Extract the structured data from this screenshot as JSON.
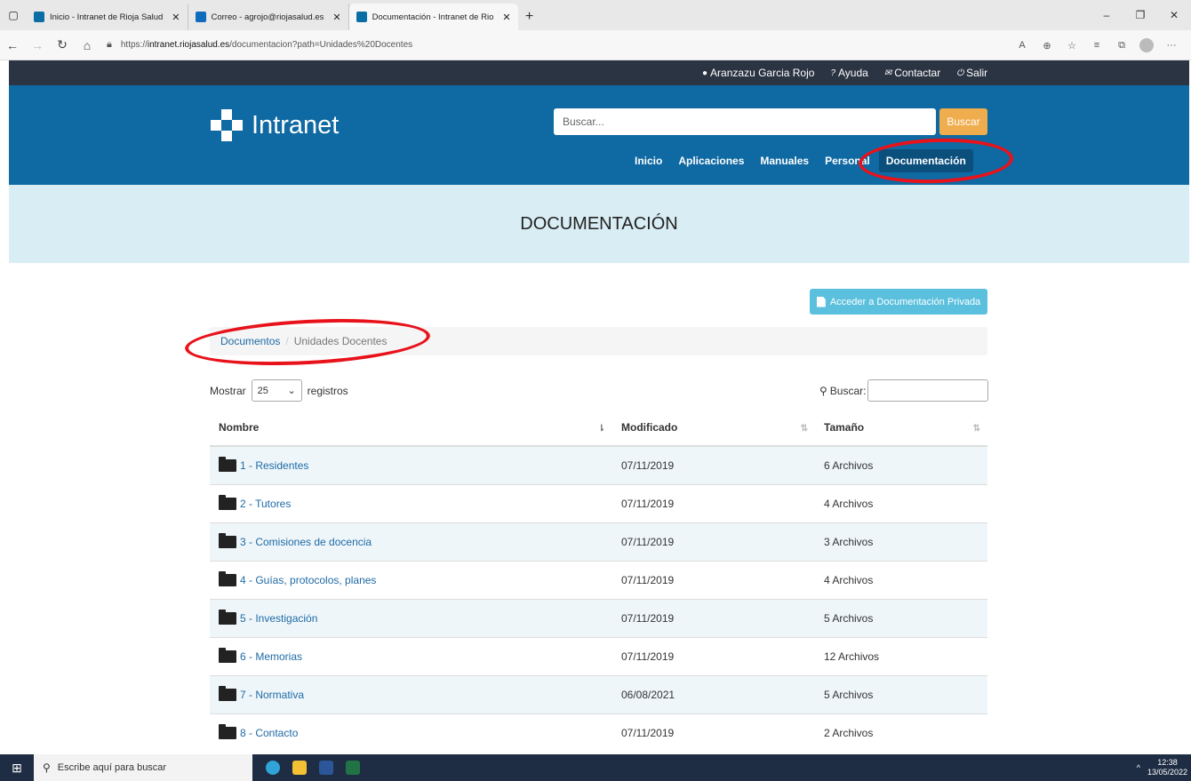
{
  "browser": {
    "tabs": [
      {
        "title": "Inicio - Intranet de Rioja Salud"
      },
      {
        "title": "Correo - agrojo@riojasalud.es"
      },
      {
        "title": "Documentación - Intranet de Rio"
      }
    ],
    "url_prefix": "https://",
    "url_host": "intranet.riojasalud.es",
    "url_path": "/documentacion?path=Unidades%20Docentes"
  },
  "topbar": {
    "user": "Aranzazu Garcia Rojo",
    "help": "Ayuda",
    "contact": "Contactar",
    "logout": "Salir"
  },
  "header": {
    "logo_text": "Intranet",
    "search_placeholder": "Buscar...",
    "search_button": "Buscar",
    "nav": [
      "Inicio",
      "Aplicaciones",
      "Manuales",
      "Personal",
      "Documentación"
    ]
  },
  "page": {
    "title": "DOCUMENTACIÓN",
    "private_button": "Acceder a Documentación Privada",
    "breadcrumb": {
      "root": "Documentos",
      "separator": "/",
      "current": "Unidades Docentes"
    },
    "show_label": "Mostrar",
    "show_value": "25",
    "records_label": "registros",
    "filter_label": "Buscar:"
  },
  "table": {
    "headers": [
      "Nombre",
      "Modificado",
      "Tamaño"
    ],
    "rows": [
      {
        "name": "1 - Residentes",
        "modified": "07/11/2019",
        "size": "6 Archivos"
      },
      {
        "name": "2 - Tutores",
        "modified": "07/11/2019",
        "size": "4 Archivos"
      },
      {
        "name": "3 - Comisiones de docencia",
        "modified": "07/11/2019",
        "size": "3 Archivos"
      },
      {
        "name": "4 - Guías, protocolos, planes",
        "modified": "07/11/2019",
        "size": "4 Archivos"
      },
      {
        "name": "5 - Investigación",
        "modified": "07/11/2019",
        "size": "5 Archivos"
      },
      {
        "name": "6 - Memorias",
        "modified": "07/11/2019",
        "size": "12 Archivos"
      },
      {
        "name": "7 - Normativa",
        "modified": "06/08/2021",
        "size": "5 Archivos"
      },
      {
        "name": "8 - Contacto",
        "modified": "07/11/2019",
        "size": "2 Archivos"
      }
    ]
  },
  "taskbar": {
    "search_placeholder": "Escribe aquí para buscar",
    "time": "12:38",
    "date": "13/05/2022"
  },
  "colors": {
    "header_blue": "#0f69a3",
    "topbar": "#2b3442",
    "search_button": "#f0ad4e",
    "private_button": "#5bc0de",
    "annotation_ring": "#e8121b"
  }
}
